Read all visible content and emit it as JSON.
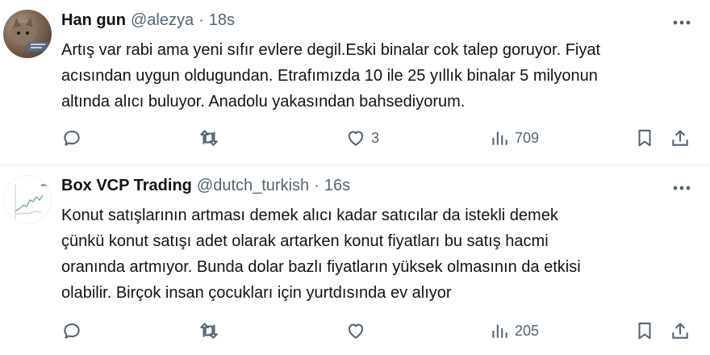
{
  "tweets": [
    {
      "display_name": "Han gun",
      "handle": "@alezya",
      "separator": "·",
      "time": "18s",
      "text": "Artış var rabi ama yeni sıfır evlere degil.Eski binalar cok talep goruyor. Fiyat\nacısından uygun oldugundan. Etrafımızda 10 ile 25 yıllık binalar 5 milyonun\naltında alıcı buluyor. Anadolu yakasından bahsediyorum.",
      "likes": "3",
      "views": "709"
    },
    {
      "display_name": "Box VCP Trading",
      "handle": "@dutch_turkish",
      "separator": "·",
      "time": "16s",
      "text": "Konut satışlarının artması demek alıcı kadar satıcılar da istekli demek\nçünkü konut satışı adet olarak artarken konut fiyatları bu satış hacmi\noranında artmıyor. Bunda dolar bazlı fiyatların yüksek olmasının da etkisi\nolabilir. Birçok insan çocukları için yurtdısında ev alıyor",
      "likes": "",
      "views": "205"
    }
  ],
  "icons": {
    "more": "more-dots-icon",
    "reply": "reply-bubble-icon",
    "retweet": "retweet-icon",
    "like": "heart-icon",
    "views": "views-bars-icon",
    "bookmark": "bookmark-icon",
    "share": "share-upload-icon"
  },
  "colors": {
    "text_primary": "#0f1419",
    "text_secondary": "#536471",
    "divider": "#e6ecf0"
  }
}
